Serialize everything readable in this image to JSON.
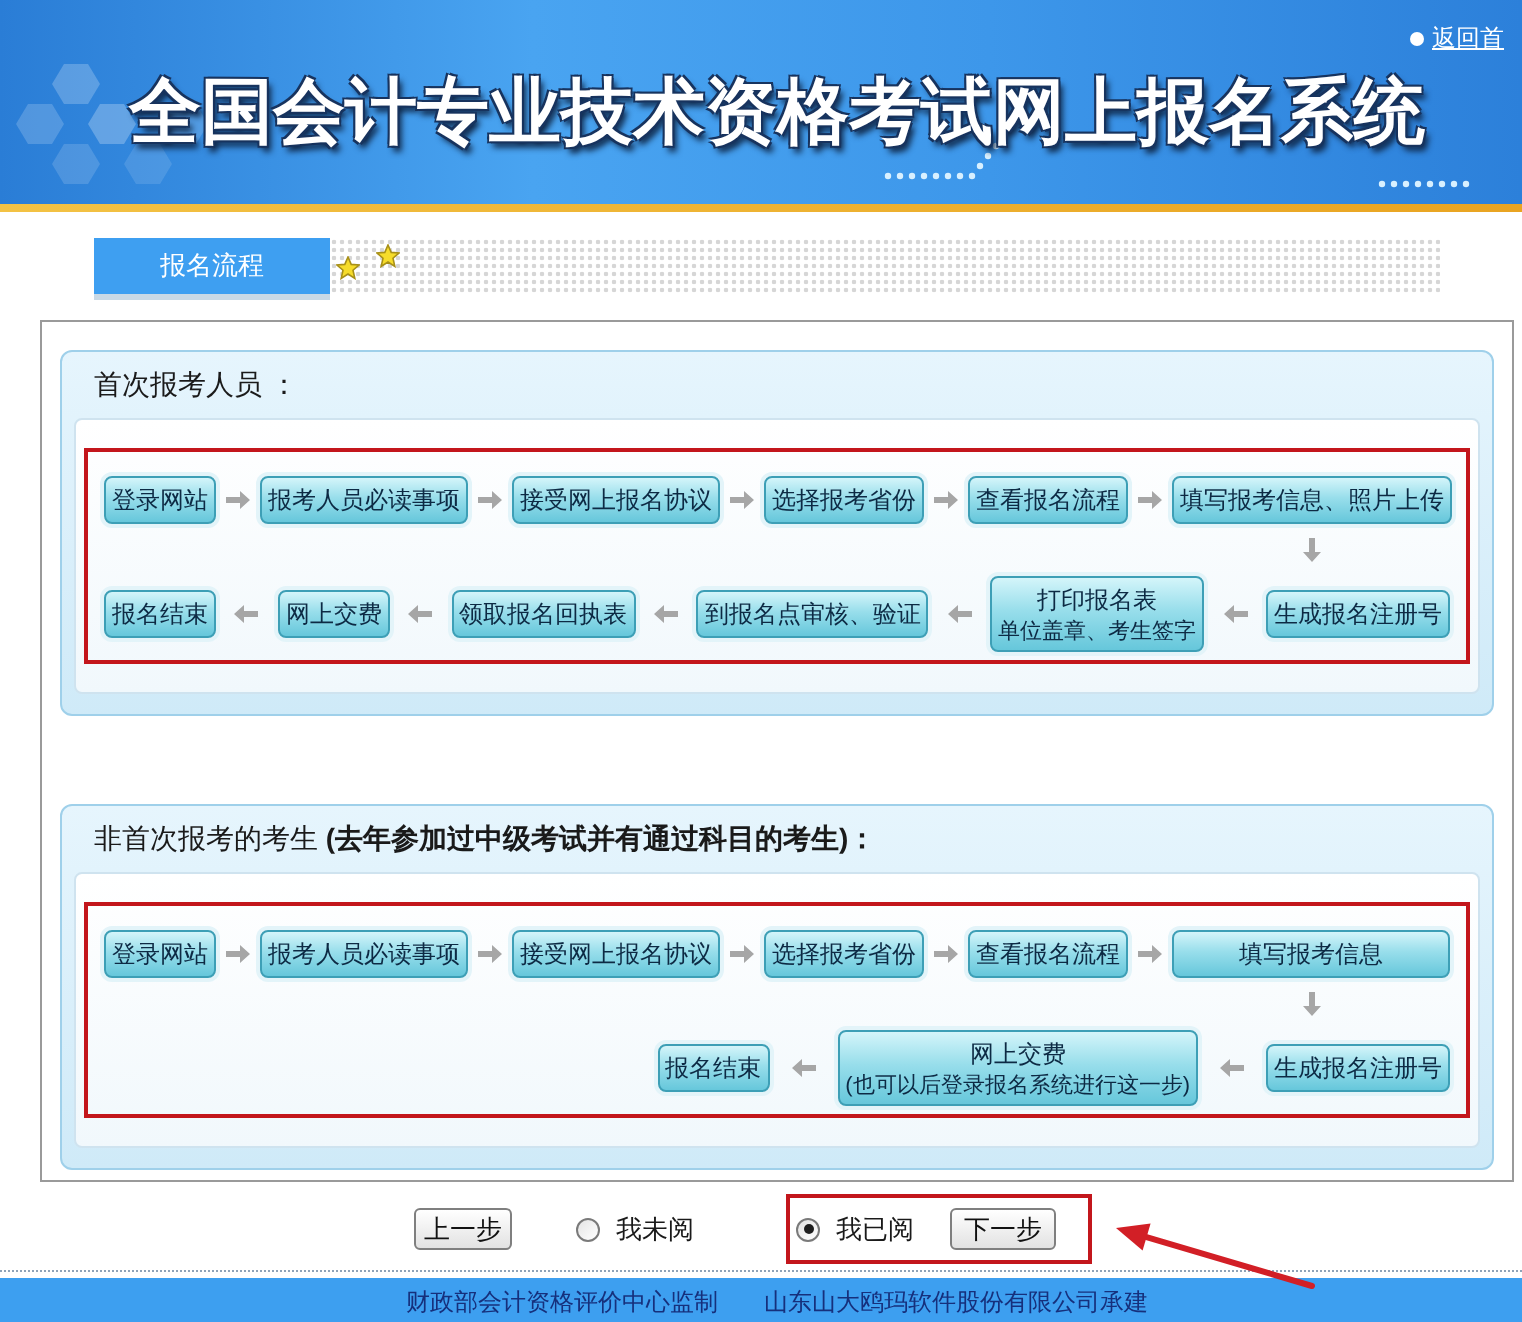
{
  "header": {
    "title": "全国会计专业技术资格考试网上报名系统",
    "home_link": "返回首"
  },
  "tab": {
    "label": "报名流程"
  },
  "sections": [
    {
      "title": "首次报考人员 ：",
      "rows": [
        {
          "kind": "rightward",
          "steps": [
            {
              "label": "登录网站"
            },
            {
              "label": "报考人员必读事项"
            },
            {
              "label": "接受网上报名协议"
            },
            {
              "label": "选择报考省份"
            },
            {
              "label": "查看报名流程"
            },
            {
              "label": "填写报考信息、照片上传"
            }
          ]
        },
        {
          "kind": "leftward",
          "steps": [
            {
              "label": "报名结束"
            },
            {
              "label": "网上交费"
            },
            {
              "label": "领取报名回执表"
            },
            {
              "label": "到报名点审核、验证"
            },
            {
              "label": "打印报名表",
              "note": "单位盖章、考生签字"
            },
            {
              "label": "生成报名注册号"
            }
          ]
        }
      ]
    },
    {
      "title": "非首次报考的考生 **(去年参加过中级考试并有通过科目的考生)：**",
      "rows": [
        {
          "kind": "rightward",
          "steps": [
            {
              "label": "登录网站"
            },
            {
              "label": "报考人员必读事项"
            },
            {
              "label": "接受网上报名协议"
            },
            {
              "label": "选择报考省份"
            },
            {
              "label": "查看报名流程"
            },
            {
              "label": "填写报考信息"
            }
          ]
        },
        {
          "kind": "leftward",
          "steps": [
            {
              "label": "报名结束"
            },
            {
              "label": "网上交费",
              "note": "(也可以后登录报名系统进行这一步)"
            },
            {
              "label": "生成报名注册号"
            }
          ]
        }
      ]
    }
  ],
  "controls": {
    "back_button": "上一步",
    "options": [
      {
        "label": "我未阅",
        "selected": false
      },
      {
        "label": "我已阅",
        "selected": true
      }
    ],
    "next_button": "下一步"
  },
  "footer": [
    "财政部会计资格评价中心监制",
    "山东山大鸥玛软件股份有限公司承建"
  ]
}
